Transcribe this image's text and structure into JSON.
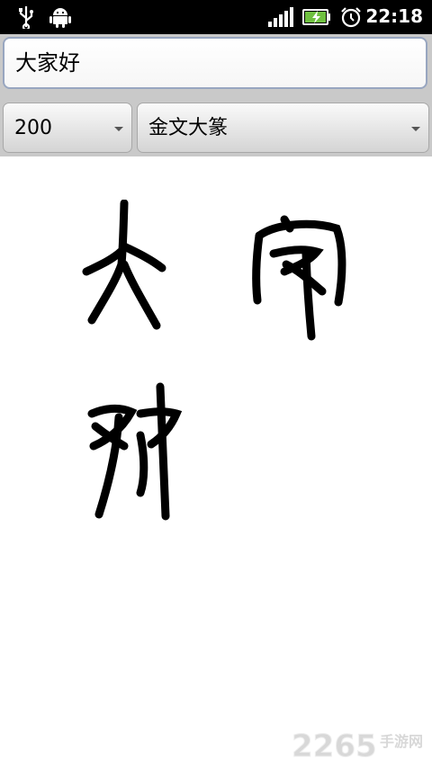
{
  "status_bar": {
    "time": "22:18",
    "icons": [
      "usb-icon",
      "android-debug-icon",
      "signal-icon",
      "battery-charging-icon",
      "alarm-icon"
    ]
  },
  "input": {
    "value": "大家好"
  },
  "size_select": {
    "value": "200"
  },
  "font_select": {
    "value": "金文大篆"
  },
  "rendered_text": {
    "characters": [
      "大",
      "家",
      "好"
    ]
  },
  "watermark": {
    "brand": "2265",
    "site": "手游网"
  }
}
